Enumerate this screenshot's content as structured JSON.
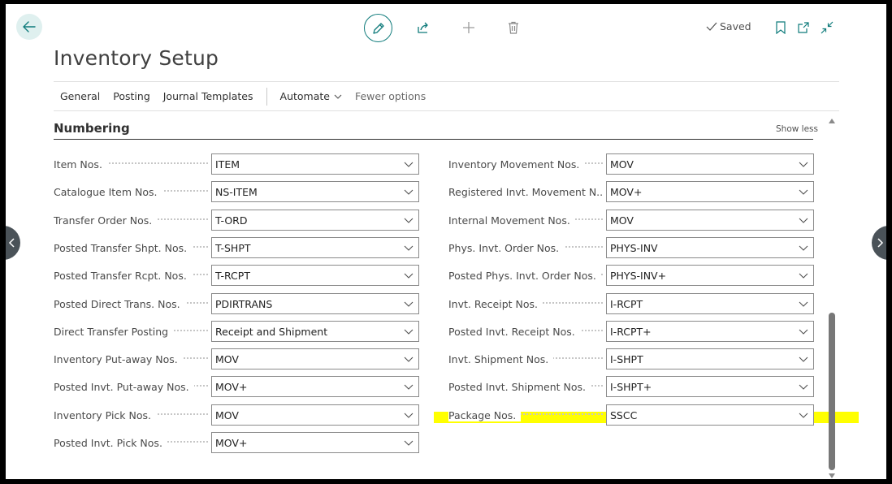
{
  "page": {
    "title": "Inventory Setup",
    "status": "Saved"
  },
  "actions": [
    {
      "label": "General"
    },
    {
      "label": "Posting"
    },
    {
      "label": "Journal Templates"
    },
    {
      "label": "Automate"
    },
    {
      "label": "Fewer options"
    }
  ],
  "section": {
    "title": "Numbering",
    "toggle": "Show less"
  },
  "left_fields": [
    {
      "label": "Item Nos.",
      "value": "ITEM"
    },
    {
      "label": "Catalogue Item Nos.",
      "value": "NS-ITEM"
    },
    {
      "label": "Transfer Order Nos.",
      "value": "T-ORD"
    },
    {
      "label": "Posted Transfer Shpt. Nos.",
      "value": "T-SHPT"
    },
    {
      "label": "Posted Transfer Rcpt. Nos.",
      "value": "T-RCPT"
    },
    {
      "label": "Posted Direct Trans. Nos.",
      "value": "PDIRTRANS"
    },
    {
      "label": "Direct Transfer Posting",
      "value": "Receipt and Shipment"
    },
    {
      "label": "Inventory Put-away Nos.",
      "value": "MOV"
    },
    {
      "label": "Posted Invt. Put-away Nos.",
      "value": "MOV+"
    },
    {
      "label": "Inventory Pick Nos.",
      "value": "MOV"
    },
    {
      "label": "Posted Invt. Pick Nos.",
      "value": "MOV+"
    }
  ],
  "right_fields": [
    {
      "label": "Inventory Movement Nos.",
      "value": "MOV"
    },
    {
      "label": "Registered Invt. Movement N...",
      "value": "MOV+"
    },
    {
      "label": "Internal Movement Nos.",
      "value": "MOV"
    },
    {
      "label": "Phys. Invt. Order Nos.",
      "value": "PHYS-INV"
    },
    {
      "label": "Posted Phys. Invt. Order Nos.",
      "value": "PHYS-INV+"
    },
    {
      "label": "Invt. Receipt Nos.",
      "value": "I-RCPT"
    },
    {
      "label": "Posted Invt. Receipt Nos.",
      "value": "I-RCPT+"
    },
    {
      "label": "Invt. Shipment Nos.",
      "value": "I-SHPT"
    },
    {
      "label": "Posted Invt. Shipment Nos.",
      "value": "I-SHPT+"
    },
    {
      "label": "Package Nos.",
      "value": "SSCC"
    }
  ],
  "colors": {
    "accent": "#0f7b7b",
    "highlight": "#ffff00"
  },
  "icons": [
    "back-arrow-icon",
    "pencil-icon",
    "share-icon",
    "plus-icon",
    "trash-icon",
    "checkmark-icon",
    "bookmark-icon",
    "open-new-window-icon",
    "collapse-icon",
    "chevron-down-icon",
    "chevron-left-icon",
    "chevron-right-icon"
  ]
}
